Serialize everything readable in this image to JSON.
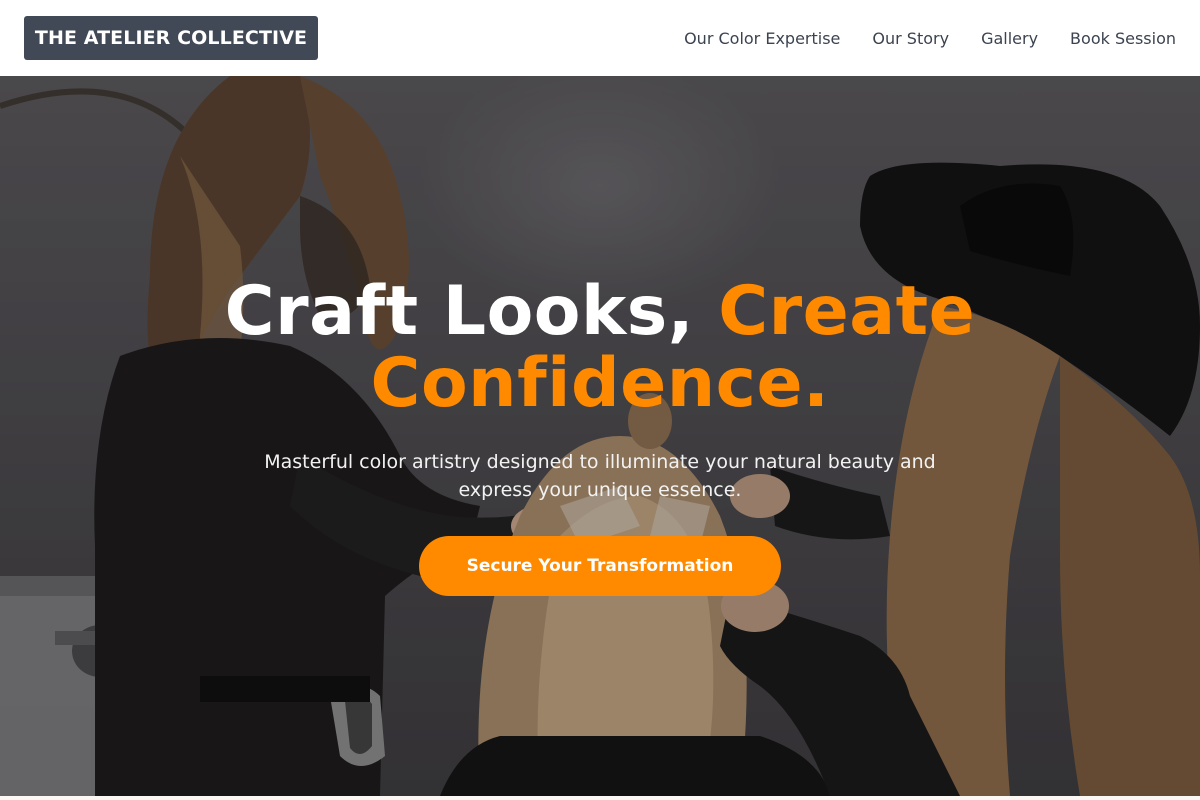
{
  "header": {
    "logo_text": "THE ATELIER COLLECTIVE",
    "nav": [
      {
        "label": "Our Color Expertise"
      },
      {
        "label": "Our Story"
      },
      {
        "label": "Gallery"
      },
      {
        "label": "Book Session"
      }
    ]
  },
  "hero": {
    "headline_white": "Craft Looks, ",
    "headline_accent_1": "Create",
    "headline_accent_2": "Confidence.",
    "subtitle": "Masterful color artistry designed to illuminate your natural beauty and express your unique essence.",
    "cta_label": "Secure Your Transformation"
  },
  "colors": {
    "accent": "#ff8a00",
    "logo_bg": "#414957",
    "nav_text": "#3c4350"
  }
}
